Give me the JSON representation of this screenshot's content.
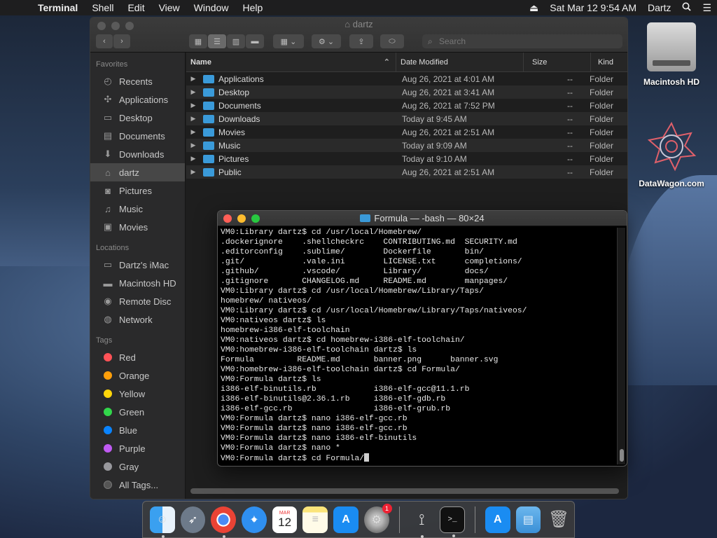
{
  "menubar": {
    "app_name": "Terminal",
    "menus": [
      "Shell",
      "Edit",
      "View",
      "Window",
      "Help"
    ],
    "datetime": "Sat Mar 12  9:54 AM",
    "user": "Dartz"
  },
  "finder": {
    "title": "dartz",
    "search_placeholder": "Search",
    "sidebar": {
      "favorites_header": "Favorites",
      "favorites": [
        {
          "label": "Recents",
          "icon": "clock-icon"
        },
        {
          "label": "Applications",
          "icon": "applications-icon"
        },
        {
          "label": "Desktop",
          "icon": "desktop-icon"
        },
        {
          "label": "Documents",
          "icon": "documents-icon"
        },
        {
          "label": "Downloads",
          "icon": "downloads-icon"
        },
        {
          "label": "dartz",
          "icon": "home-icon"
        },
        {
          "label": "Pictures",
          "icon": "camera-icon"
        },
        {
          "label": "Music",
          "icon": "music-icon"
        },
        {
          "label": "Movies",
          "icon": "film-icon"
        }
      ],
      "locations_header": "Locations",
      "locations": [
        {
          "label": "Dartz's iMac",
          "icon": "imac-icon"
        },
        {
          "label": "Macintosh HD",
          "icon": "drive-icon"
        },
        {
          "label": "Remote Disc",
          "icon": "disc-icon"
        },
        {
          "label": "Network",
          "icon": "globe-icon"
        }
      ],
      "tags_header": "Tags",
      "tags": [
        {
          "label": "Red",
          "color": "#ff5257"
        },
        {
          "label": "Orange",
          "color": "#ff9f0a"
        },
        {
          "label": "Yellow",
          "color": "#ffd60a"
        },
        {
          "label": "Green",
          "color": "#32d74b"
        },
        {
          "label": "Blue",
          "color": "#0a84ff"
        },
        {
          "label": "Purple",
          "color": "#bf5af2"
        },
        {
          "label": "Gray",
          "color": "#98989d"
        },
        {
          "label": "All Tags...",
          "color": "#555555"
        }
      ]
    },
    "columns": {
      "name": "Name",
      "date": "Date Modified",
      "size": "Size",
      "kind": "Kind"
    },
    "rows": [
      {
        "name": "Applications",
        "date": "Aug 26, 2021 at 4:01 AM",
        "size": "--",
        "kind": "Folder"
      },
      {
        "name": "Desktop",
        "date": "Aug 26, 2021 at 3:41 AM",
        "size": "--",
        "kind": "Folder"
      },
      {
        "name": "Documents",
        "date": "Aug 26, 2021 at 7:52 PM",
        "size": "--",
        "kind": "Folder"
      },
      {
        "name": "Downloads",
        "date": "Today at 9:45 AM",
        "size": "--",
        "kind": "Folder"
      },
      {
        "name": "Movies",
        "date": "Aug 26, 2021 at 2:51 AM",
        "size": "--",
        "kind": "Folder"
      },
      {
        "name": "Music",
        "date": "Today at 9:09 AM",
        "size": "--",
        "kind": "Folder"
      },
      {
        "name": "Pictures",
        "date": "Today at 9:10 AM",
        "size": "--",
        "kind": "Folder"
      },
      {
        "name": "Public",
        "date": "Aug 26, 2021 at 2:51 AM",
        "size": "--",
        "kind": "Folder"
      }
    ]
  },
  "terminal": {
    "title": "Formula — -bash — 80×24",
    "lines": [
      "VM0:Library dartz$ cd /usr/local/Homebrew/",
      ".dockerignore    .shellcheckrc    CONTRIBUTING.md  SECURITY.md",
      ".editorconfig    .sublime/        Dockerfile       bin/",
      ".git/            .vale.ini        LICENSE.txt      completions/",
      ".github/         .vscode/         Library/         docs/",
      ".gitignore       CHANGELOG.md     README.md        manpages/",
      "VM0:Library dartz$ cd /usr/local/Homebrew/Library/Taps/",
      "homebrew/ nativeos/",
      "VM0:Library dartz$ cd /usr/local/Homebrew/Library/Taps/nativeos/",
      "VM0:nativeos dartz$ ls",
      "homebrew-i386-elf-toolchain",
      "VM0:nativeos dartz$ cd homebrew-i386-elf-toolchain/",
      "VM0:homebrew-i386-elf-toolchain dartz$ ls",
      "Formula         README.md       banner.png      banner.svg",
      "VM0:homebrew-i386-elf-toolchain dartz$ cd Formula/",
      "VM0:Formula dartz$ ls",
      "i386-elf-binutils.rb            i386-elf-gcc@11.1.rb",
      "i386-elf-binutils@2.36.1.rb     i386-elf-gdb.rb",
      "i386-elf-gcc.rb                 i386-elf-grub.rb",
      "VM0:Formula dartz$ nano i386-elf-gcc.rb",
      "VM0:Formula dartz$ nano i386-elf-gcc.rb",
      "VM0:Formula dartz$ nano i386-elf-binutils",
      "VM0:Formula dartz$ nano *",
      "VM0:Formula dartz$ cd Formula/"
    ]
  },
  "desktop": {
    "icons": [
      {
        "label": "Macintosh HD"
      },
      {
        "label": "DataWagon.com"
      }
    ]
  },
  "dock": {
    "calendar_month": "MAR",
    "calendar_day": "12",
    "updates_badge": "1"
  }
}
